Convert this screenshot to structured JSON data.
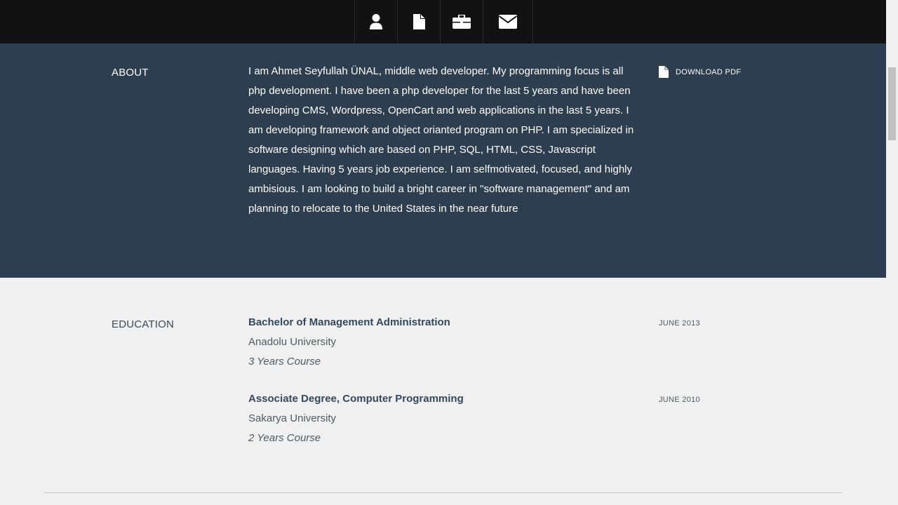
{
  "nav": {
    "icons": [
      "user-icon",
      "document-icon",
      "briefcase-icon",
      "envelope-icon"
    ]
  },
  "about": {
    "label": "ABOUT",
    "text": "I am Ahmet Seyfullah ÜNAL, middle web developer. My programming focus is all php development. I have been a php developer for the last 5 years and have been developing CMS, Wordpress, OpenCart and web applications in the last 5 years. I am developing framework and object orianted program on PHP. I am specialized in software designing which are based on PHP, SQL, HTML, CSS, Javascript languages. Having 5 years job experience. I am selfmotivated, focused, and highly ambisious. I am looking to build a bright career in \"software management\" and am planning to relocate to the United States in the near future",
    "download_label": "DOWNLOAD PDF"
  },
  "education": {
    "label": "EDUCATION",
    "items": [
      {
        "degree": "Bachelor of Management Administration",
        "school": "Anadolu University",
        "course": "3 Years Course",
        "date": "JUNE 2013"
      },
      {
        "degree": "Associate Degree, Computer Programming",
        "school": "Sakarya University",
        "course": "2 Years Course",
        "date": "JUNE 2010"
      }
    ]
  },
  "colors": {
    "nav_bg": "#121212",
    "about_bg": "#2d3e50",
    "page_bg": "#f0f0f0",
    "heading": "#34495e"
  }
}
